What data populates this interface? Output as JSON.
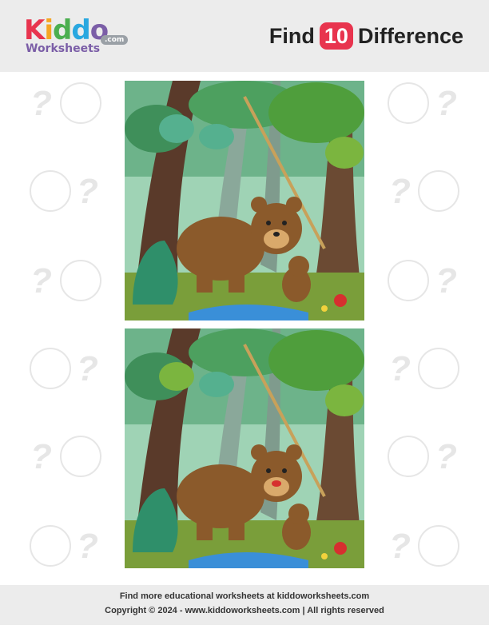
{
  "header": {
    "logo": {
      "brand_letters": [
        "K",
        "i",
        "d",
        "d",
        "o"
      ],
      "subtitle": "Worksheets",
      "domain": ".com"
    },
    "title_prefix": "Find",
    "title_number": "10",
    "title_suffix": "Difference"
  },
  "colors": {
    "header_bg": "#ececec",
    "accent": "#e8344e",
    "logo_letters": [
      "#e8344e",
      "#f5a623",
      "#4caf50",
      "#29a8e0",
      "#7b5ea7"
    ],
    "marker": "#e6e6e6",
    "bear_brown": "#8b5a2b",
    "water": "#3a8fd8"
  },
  "images": [
    {
      "name": "top-picture",
      "description_icon": "bear-forest-scene"
    },
    {
      "name": "bottom-picture",
      "description_icon": "bear-forest-scene"
    }
  ],
  "markers": {
    "symbol": "?"
  },
  "footer": {
    "line1": "Find more educational worksheets at kiddoworksheets.com",
    "line2": "Copyright © 2024 - www.kiddoworksheets.com  |  All rights reserved"
  }
}
